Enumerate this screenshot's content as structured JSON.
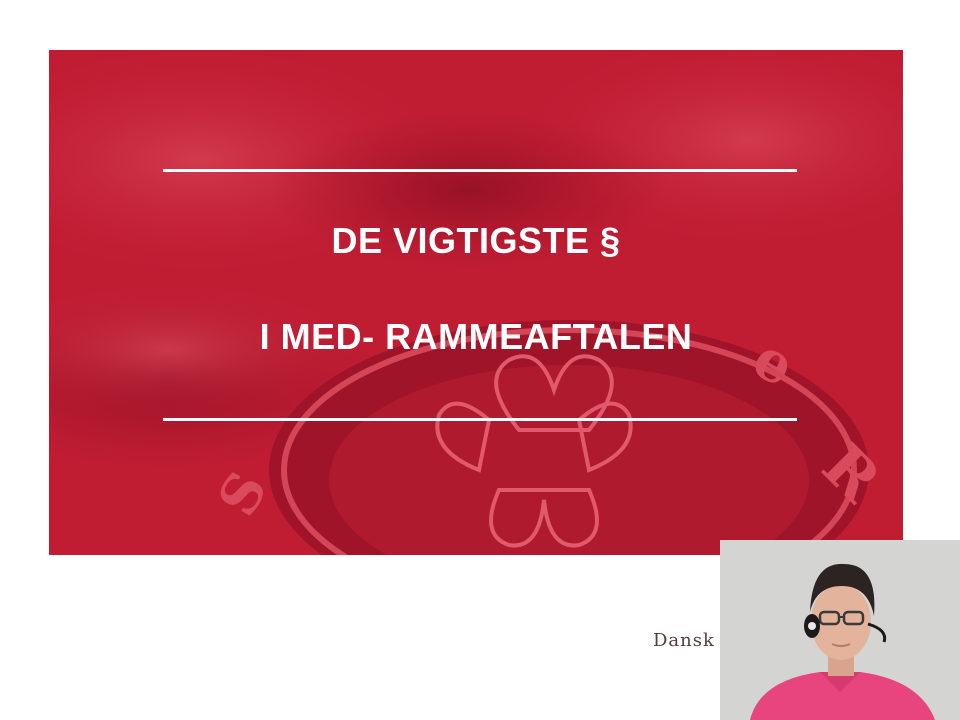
{
  "slide": {
    "title_line_1": "DE VIGTIGSTE §",
    "title_line_2": "I MED- RAMMEAFTALEN",
    "brand_text": "Dansk"
  },
  "colors": {
    "banner_red": "#c41e34",
    "text_white": "#ffffff",
    "brand_text": "#5a3a3a",
    "presenter_shirt": "#e8457f"
  },
  "webcam": {
    "icon": "presenter-video"
  }
}
